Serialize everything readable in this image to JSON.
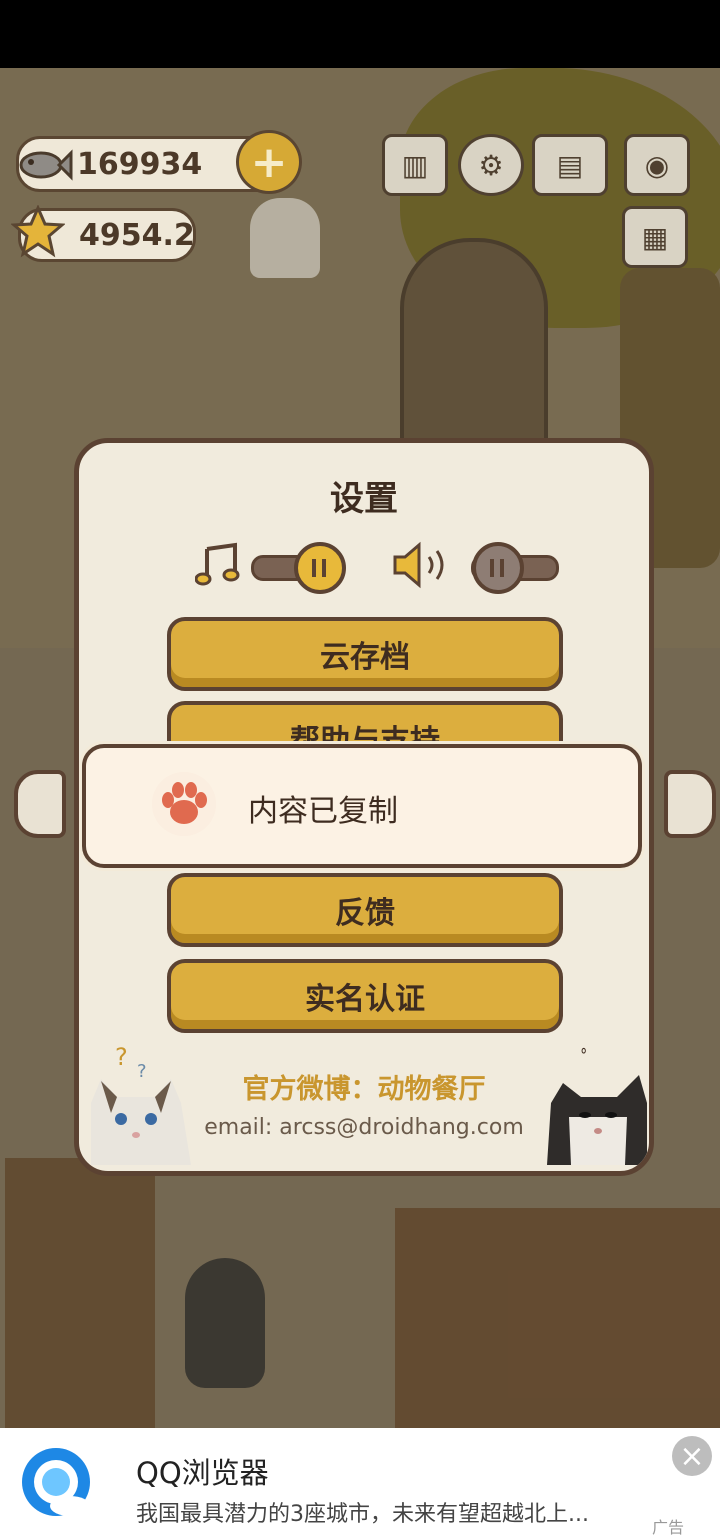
{
  "hud": {
    "fish_count": "169934",
    "star_count": "4954.2",
    "plus_label": "+",
    "icons": [
      "fish-icon",
      "star-icon",
      "ranking-icon",
      "settings-gear-icon",
      "cat-album-icon",
      "camera-icon",
      "notice-board-icon"
    ]
  },
  "settings": {
    "title": "设置",
    "music_enabled": true,
    "sound_enabled": false,
    "buttons": {
      "cloud_save": "云存档",
      "help_support": "帮助与支持",
      "feedback": "反馈",
      "real_name": "实名认证"
    },
    "weibo": "官方微博：动物餐厅",
    "email": "email: arcss@droidhang.com"
  },
  "toast": {
    "icon": "paw-icon",
    "message": "内容已复制"
  },
  "ad": {
    "app_name": "QQ浏览器",
    "description": "我国最具潜力的3座城市，未来有望超越北上...",
    "tag": "广告",
    "close_label": "×"
  },
  "colors": {
    "dialog_bg": "#f1ebdd",
    "button_gold": "#dcae3e",
    "border_brown": "#5b4232",
    "weibo_text": "#c9962e",
    "toast_bg": "#fcf2e4",
    "paw_red": "#e06a4f"
  }
}
